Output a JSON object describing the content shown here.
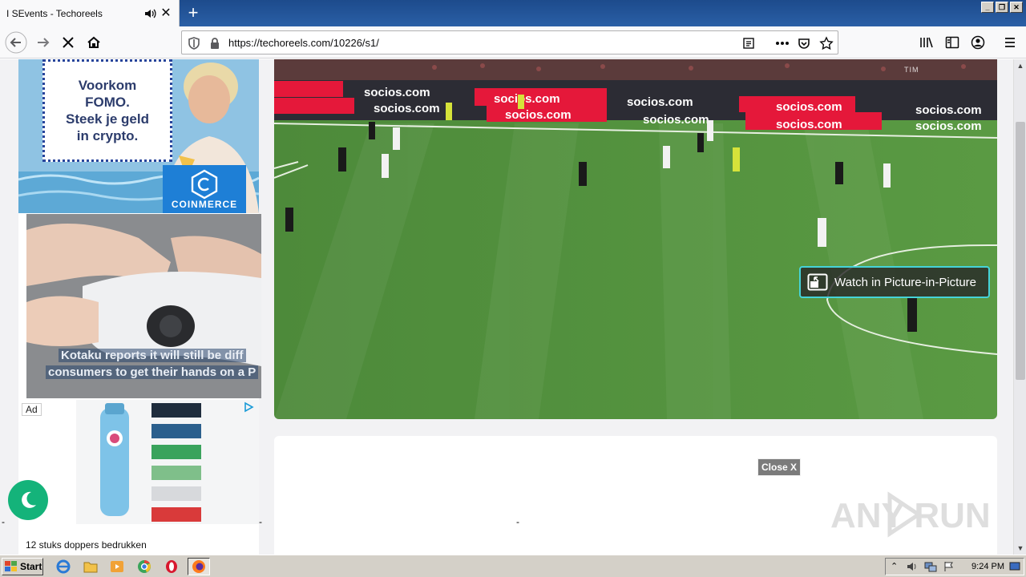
{
  "browser": {
    "tab_title": "I SEvents - Techoreels",
    "url": "https://techoreels.com/10226/s1/"
  },
  "ads": {
    "coinmerce_text": "Voorkom\nFOMO.\nSteek je geld\nin crypto.",
    "coinmerce_brand": "COINMERCE",
    "video_caption_line1": "Kotaku reports it will still be diff",
    "video_caption_line2": "consumers to get their hands on a P",
    "ad_label": "Ad",
    "doppers_caption": "12 stuks doppers bedrukken"
  },
  "video": {
    "pip_label": "Watch in Picture-in-Picture",
    "board_text": "socios.com",
    "channel_badge": "TIM"
  },
  "panel": {
    "close_label": "Close X",
    "dash": "-"
  },
  "watermark": "ANY RUN",
  "taskbar": {
    "start_label": "Start",
    "clock": "9:24 PM"
  }
}
